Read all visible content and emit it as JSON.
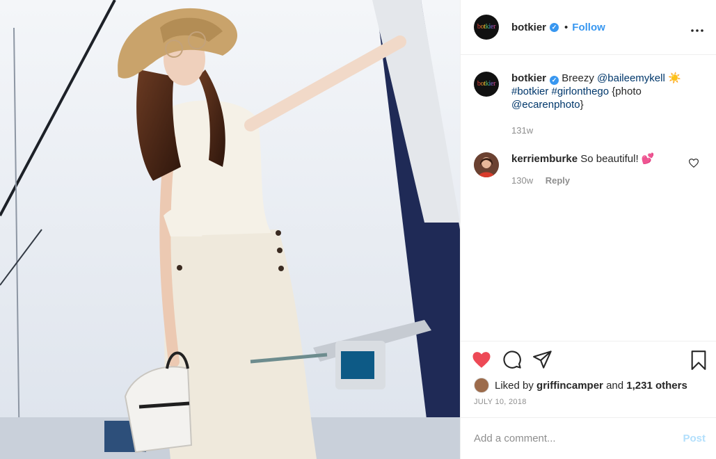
{
  "post": {
    "username": "botkier",
    "follow_label": "Follow",
    "separator": "•",
    "more_label": "•••",
    "avatar_logo_letters": [
      "b",
      "o",
      "t",
      "k",
      "i",
      "e",
      "r"
    ]
  },
  "caption": {
    "username": "botkier",
    "text_prefix": "Breezy",
    "mention1": "@baileemykell",
    "emoji": "☀️",
    "hashtag1": "#botkier",
    "hashtag2": "#girlonthego",
    "photo_text": "{photo",
    "mention2": "@ecarenphoto",
    "closing": "}",
    "time": "131w"
  },
  "comments": [
    {
      "username": "kerriemburke",
      "text": "So beautiful!",
      "emoji": "💕",
      "time": "130w",
      "reply_label": "Reply"
    }
  ],
  "likes": {
    "prefix": "Liked by",
    "user": "griffincamper",
    "and": "and",
    "others": "1,231 others"
  },
  "date": "JULY 10, 2018",
  "add_comment": {
    "placeholder": "Add a comment...",
    "post_label": "Post"
  },
  "colors": {
    "accent": "#3897f0",
    "like": "#ed4956",
    "muted": "#8e8e8e",
    "post_disabled": "#b2dffc"
  }
}
